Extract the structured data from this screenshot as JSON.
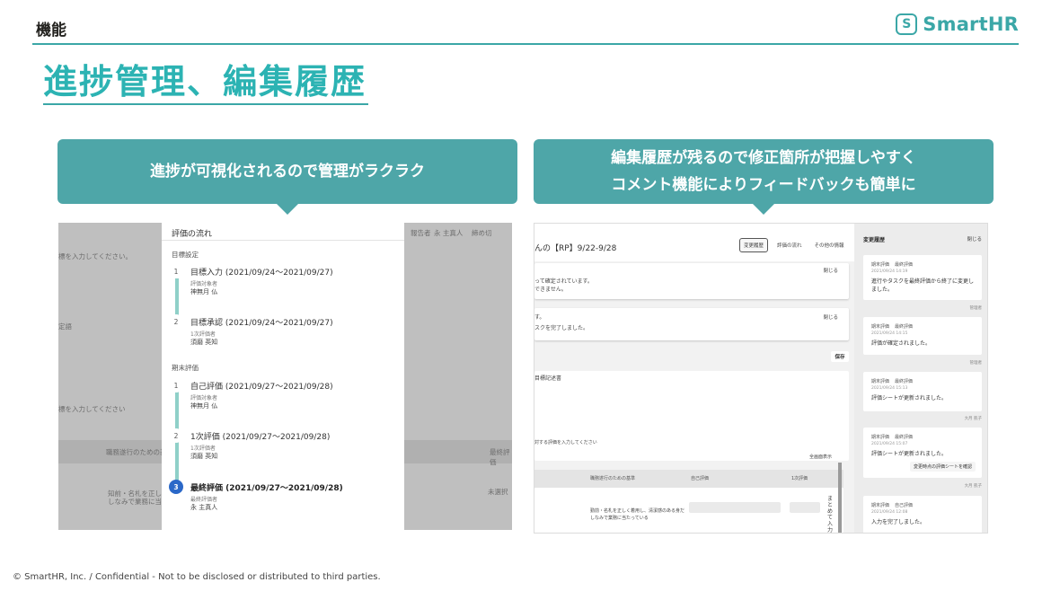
{
  "header": {
    "section_label": "機能",
    "brand_mark": "S",
    "brand_name": "SmartHR"
  },
  "page_title": "進捗管理、編集履歴",
  "callouts": {
    "left": {
      "line1": "進捗が可視化されるので管理がラクラク"
    },
    "right": {
      "line1": "編集履歴が残るので修正箇所が把握しやすく",
      "line2": "コメント機能によりフィードバックも簡単に"
    }
  },
  "left_screenshot": {
    "bg_texts": [
      "報告者",
      "永 主真人",
      "締め切",
      "標を入力してください。",
      "定語",
      "標を入力してください",
      "職務遂行のための基準",
      "最終評価",
      "知前・名札を正しく着用",
      "しなみで業務に当たって",
      "未選択"
    ],
    "panel_title": "評価の流れ",
    "phases": [
      "目標設定",
      "期末評価"
    ],
    "steps": [
      {
        "num": "1",
        "title": "目標入力 (2021/09/24〜2021/09/27)",
        "role": "評価対象者",
        "person": "神無月 仏"
      },
      {
        "num": "2",
        "title": "目標承認 (2021/09/24〜2021/09/27)",
        "role": "1次評価者",
        "person": "須磨 英知"
      },
      {
        "num": "1",
        "title": "自己評価 (2021/09/27〜2021/09/28)",
        "role": "評価対象者",
        "person": "神無月 仏"
      },
      {
        "num": "2",
        "title": "1次評価 (2021/09/27〜2021/09/28)",
        "role": "1次評価者",
        "person": "須磨 英知"
      },
      {
        "num": "3",
        "title": "最終評価 (2021/09/27〜2021/09/28)",
        "role": "最終評価者",
        "person": "永 主真人"
      }
    ]
  },
  "right_screenshot": {
    "page_title": "んの【RP】9/22-9/28",
    "tabs": [
      "変更履歴",
      "評価の流れ",
      "その他の情報"
    ],
    "close_label": "閉じる",
    "card1_lines": [
      "って確定されています。",
      "できません。"
    ],
    "card2_lines": [
      "す。",
      "スクを完了しました。"
    ],
    "save_label": "保存",
    "section_label": "目標記述書",
    "prompt_text": "対する評価を入力してください",
    "expand_label": "全画面表示",
    "table_headers": [
      "職務遂行のための基準",
      "自己評価",
      "1次評価"
    ],
    "row_text_1": "勤前・名札を正しく着用し、清潔感のある身だ",
    "row_text_2": "しなみで業務に当たっている",
    "edit_label": "まとめて入力",
    "history": {
      "title": "変更履歴",
      "close_label": "閉じる",
      "entries": [
        {
          "tags": [
            "期末評価",
            "最終評価"
          ],
          "ts": "2021/09/24 14:19",
          "msg": "進行やタスクを最終評価から終了に変更しました。",
          "author": "管理者"
        },
        {
          "tags": [
            "期末評価",
            "最終評価"
          ],
          "ts": "2021/09/24 14:15",
          "msg": "評価が確定されました。",
          "author": "管理者"
        },
        {
          "tags": [
            "期末評価",
            "最終評価"
          ],
          "ts": "2021/09/24 15:13",
          "msg": "評価シートが更新されました。",
          "author": "大月 凱子"
        },
        {
          "tags": [
            "期末評価",
            "最終評価"
          ],
          "ts": "2021/09/24 15:07",
          "msg": "評価シートが更新されました。",
          "btn": "変更時点の評価シートを確認",
          "author": "大月 凱子"
        },
        {
          "tags": [
            "期末評価",
            "自己評価"
          ],
          "ts": "2021/09/24 12:08",
          "msg": "入力を完了しました。"
        }
      ]
    }
  },
  "footer": "© SmartHR, Inc. / Confidential - Not to be disclosed or distributed to third parties."
}
